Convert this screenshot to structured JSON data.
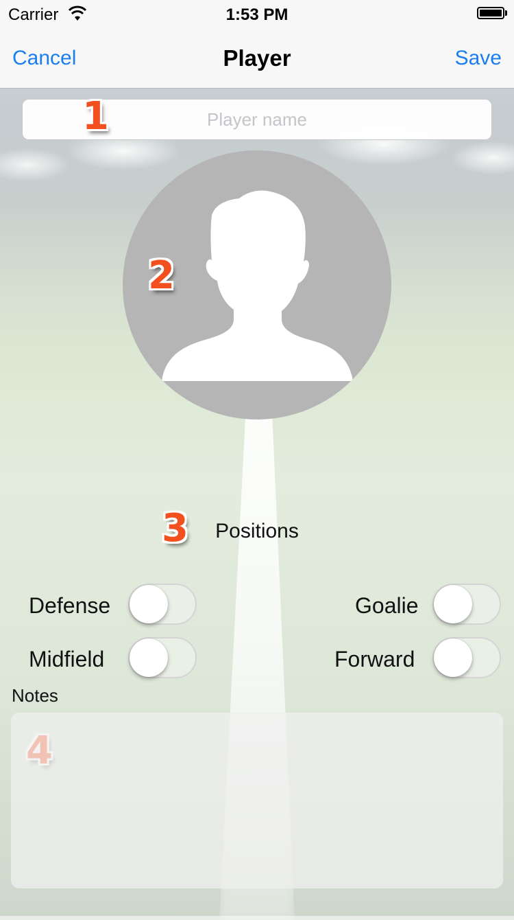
{
  "status_bar": {
    "carrier": "Carrier",
    "time": "1:53 PM"
  },
  "nav": {
    "cancel": "Cancel",
    "title": "Player",
    "save": "Save"
  },
  "form": {
    "name_placeholder": "Player name",
    "name_value": "",
    "positions_label": "Positions",
    "positions": [
      {
        "label": "Defense",
        "on": false
      },
      {
        "label": "Goalie",
        "on": false
      },
      {
        "label": "Midfield",
        "on": false
      },
      {
        "label": "Forward",
        "on": false
      }
    ],
    "notes_label": "Notes",
    "notes_value": ""
  },
  "badges": [
    "1",
    "2",
    "3",
    "4"
  ],
  "colors": {
    "accent": "#1a7ef0",
    "badge": "#f2501f",
    "avatar_bg": "#b5b5b5"
  }
}
